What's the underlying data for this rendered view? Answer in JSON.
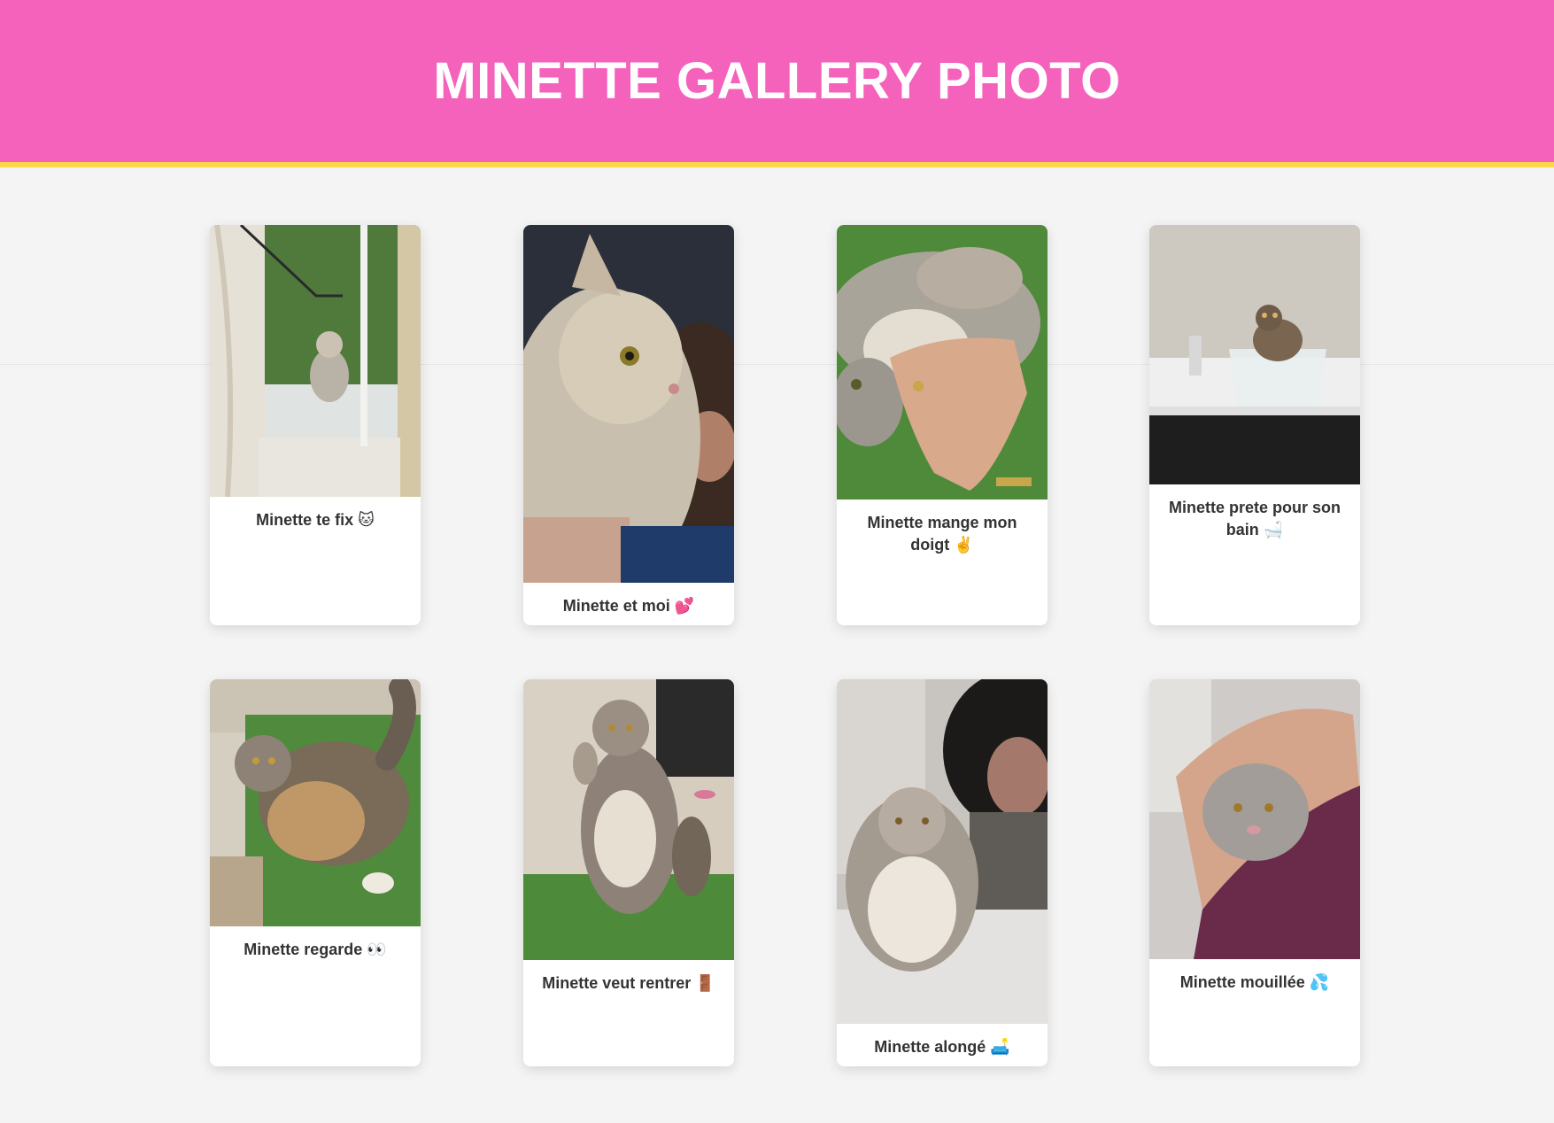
{
  "header": {
    "title": "MINETTE GALLERY PHOTO"
  },
  "gallery": {
    "cards": [
      {
        "caption": "Minette te fix 🐱",
        "photo": "cat-behind-window-photo"
      },
      {
        "caption": "Minette et moi 💕",
        "photo": "cat-held-close-photo"
      },
      {
        "caption": "Minette mange mon doigt ✌️",
        "photo": "cat-biting-finger-photo"
      },
      {
        "caption": "Minette prete pour son bain 🛁",
        "photo": "cat-in-basin-photo"
      },
      {
        "caption": "Minette regarde 👀",
        "photo": "cat-on-grass-photo"
      },
      {
        "caption": "Minette veut rentrer 🚪",
        "photo": "cat-standing-door-photo"
      },
      {
        "caption": "Minette alongé 🛋️",
        "photo": "cat-lying-bed-photo"
      },
      {
        "caption": "Minette mouillée 💦",
        "photo": "wet-cat-in-towel-photo"
      }
    ]
  },
  "colors": {
    "header_bg": "#f562bb",
    "header_border": "#ffd54a",
    "page_bg": "#f4f4f4",
    "card_bg": "#ffffff",
    "caption_text": "#333333"
  }
}
